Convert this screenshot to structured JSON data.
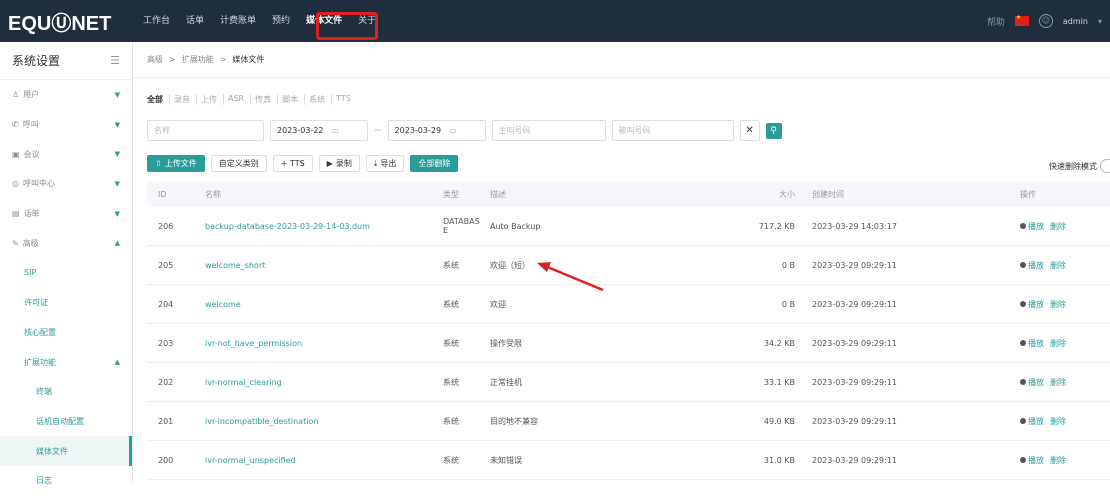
{
  "brand": "EQUⓊNET",
  "nav": [
    "工作台",
    "话单",
    "计费账单",
    "预约",
    "媒体文件",
    "关于"
  ],
  "topright": {
    "help": "帮助",
    "user": "admin"
  },
  "sidebar": {
    "title": "系统设置",
    "items": [
      {
        "label": "用户",
        "icon": "user-icon"
      },
      {
        "label": "呼叫",
        "icon": "phone-icon"
      },
      {
        "label": "会议",
        "icon": "chat-icon"
      },
      {
        "label": "呼叫中心",
        "icon": "headset-icon"
      },
      {
        "label": "话单",
        "icon": "doc-icon"
      },
      {
        "label": "高级",
        "icon": "wrench-icon"
      }
    ],
    "sub": [
      "SIP",
      "许可证",
      "核心配置"
    ],
    "ext_label": "扩展功能",
    "sub2": [
      "终端",
      "话机自动配置",
      "媒体文件",
      "日志"
    ]
  },
  "breadcrumb": [
    "高级",
    "扩展功能",
    "媒体文件"
  ],
  "filters": [
    "全部",
    "录音",
    "上传",
    "ASR",
    "传真",
    "脚本",
    "系统",
    "TTS"
  ],
  "search": {
    "name_placeholder": "名称",
    "date_from": "2023-03-22",
    "date_to": "2023-03-29",
    "caller_placeholder": "主叫号码",
    "callee_placeholder": "被叫号码"
  },
  "actions": {
    "upload": "上传文件",
    "custom_type": "自定义类别",
    "tts": "+ TTS",
    "record": "录制",
    "export": "导出",
    "bulk_delete": "全部删除",
    "quick_delete": "快速删除模式"
  },
  "table": {
    "headers": [
      "ID",
      "名称",
      "类型",
      "描述",
      "大小",
      "创建时间",
      "操作"
    ],
    "rows": [
      {
        "id": "206",
        "name": "backup-database-2023-03-29-14-03.dum",
        "type": "DATABASE",
        "desc": "Auto Backup",
        "size": "717.2 KB",
        "time": "2023-03-29 14:03:17"
      },
      {
        "id": "205",
        "name": "welcome_short",
        "type": "系统",
        "desc": "欢迎（短）",
        "size": "0 B",
        "time": "2023-03-29 09:29:11"
      },
      {
        "id": "204",
        "name": "welcome",
        "type": "系统",
        "desc": "欢迎",
        "size": "0 B",
        "time": "2023-03-29 09:29:11"
      },
      {
        "id": "203",
        "name": "ivr-not_have_permission",
        "type": "系统",
        "desc": "操作受限",
        "size": "34.2 KB",
        "time": "2023-03-29 09:29:11"
      },
      {
        "id": "202",
        "name": "ivr-normal_clearing",
        "type": "系统",
        "desc": "正常挂机",
        "size": "33.1 KB",
        "time": "2023-03-29 09:29:11"
      },
      {
        "id": "201",
        "name": "ivr-incompatible_destination",
        "type": "系统",
        "desc": "目的地不兼容",
        "size": "49.0 KB",
        "time": "2023-03-29 09:29:11"
      },
      {
        "id": "200",
        "name": "ivr-normal_unspecified",
        "type": "系统",
        "desc": "未知错误",
        "size": "31.0 KB",
        "time": "2023-03-29 09:29:11"
      }
    ],
    "op_play": "播放",
    "op_delete": "删除"
  }
}
